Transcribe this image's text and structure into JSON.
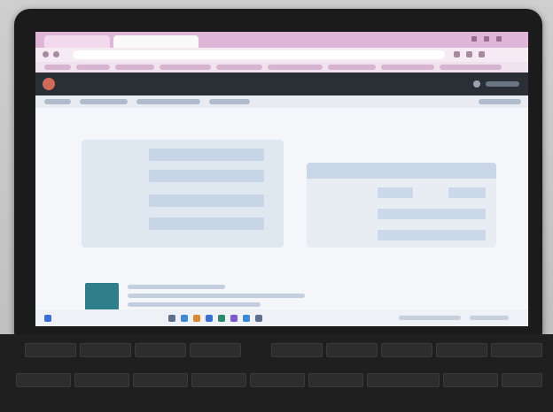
{
  "browser": {
    "tabs": [
      {
        "label": "",
        "active": false
      },
      {
        "label": "",
        "active": true
      }
    ],
    "url": ""
  },
  "app": {
    "brand_line_1": "",
    "brand_line_2": ""
  },
  "page": {
    "title": ""
  },
  "form": {
    "fields": [
      {
        "label": "",
        "value": ""
      },
      {
        "label": "",
        "value": ""
      },
      {
        "label": "",
        "value": ""
      },
      {
        "label": "",
        "value": ""
      }
    ]
  },
  "side_panel": {
    "header": ""
  },
  "note": {
    "badge": ""
  },
  "colors": {
    "accent": "#2f7f8a",
    "tabbar": "#e0b6d8",
    "appbar": "#2a2f36"
  }
}
